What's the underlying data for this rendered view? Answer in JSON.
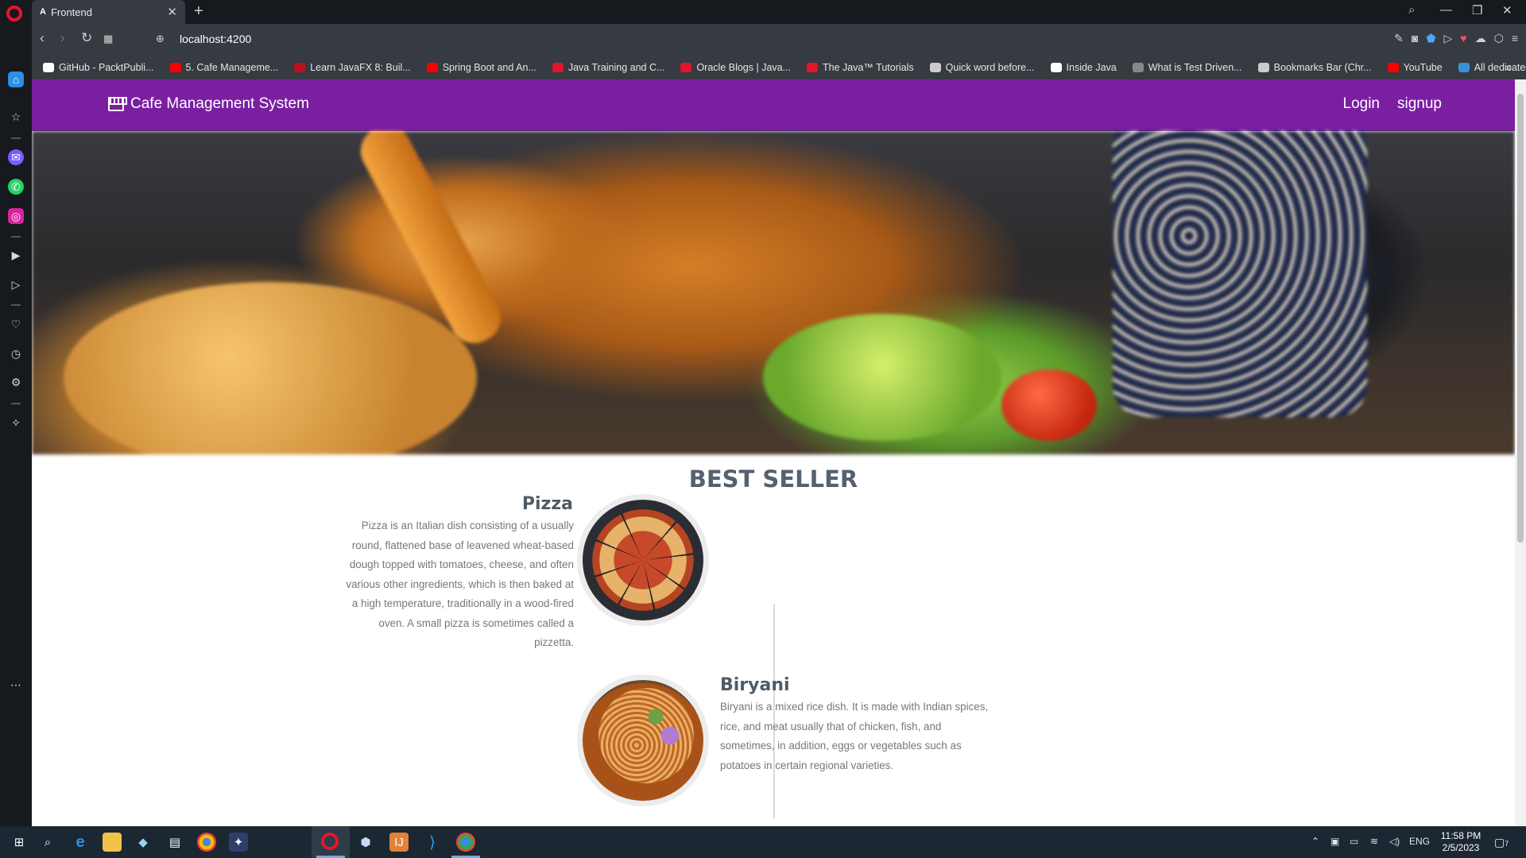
{
  "browser": {
    "tab_title": "Frontend",
    "tab_icon_glyph": "A",
    "close_glyph": "✕",
    "new_tab_glyph": "+",
    "url": "localhost:4200",
    "bookmarks": [
      {
        "label": "GitHub - PacktPubli...",
        "icon": "github-icon",
        "color": "#ffffff"
      },
      {
        "label": "5. Cafe Manageme...",
        "icon": "youtube-icon",
        "color": "#ff0000"
      },
      {
        "label": "Learn JavaFX 8: Buil...",
        "icon": "packt-icon",
        "color": "#b7121f"
      },
      {
        "label": "Spring Boot and An...",
        "icon": "youtube-icon",
        "color": "#ff0000"
      },
      {
        "label": "Java Training and C...",
        "icon": "oracle-icon",
        "color": "#e3152b"
      },
      {
        "label": "Oracle Blogs | Java...",
        "icon": "oracle-icon",
        "color": "#e3152b"
      },
      {
        "label": "The Java™ Tutorials",
        "icon": "oracle-icon",
        "color": "#e3152b"
      },
      {
        "label": "Quick word before...",
        "icon": "globe-icon",
        "color": "#cccccc"
      },
      {
        "label": "Inside Java",
        "icon": "page-icon",
        "color": "#ffffff"
      },
      {
        "label": "What is Test Driven...",
        "icon": "site-icon",
        "color": "#888888"
      },
      {
        "label": "Bookmarks Bar (Chr...",
        "icon": "folder-icon",
        "color": "#cccccc"
      },
      {
        "label": "YouTube",
        "icon": "youtube-icon",
        "color": "#ff0000"
      },
      {
        "label": "All dedicated MOO...",
        "icon": "infinity-icon",
        "color": "#3b8fd8"
      }
    ]
  },
  "page": {
    "brand": "Cafe Management System",
    "nav": {
      "login": "Login",
      "signup": "signup"
    },
    "section_title": "BEST SELLER",
    "items": [
      {
        "name": "Pizza",
        "description": "Pizza is an Italian dish consisting of a usually round, flattened base of leavened wheat-based dough topped with tomatoes, cheese, and often various other ingredients, which is then baked at a high temperature, traditionally in a wood-fired oven. A small pizza is sometimes called a pizzetta."
      },
      {
        "name": "Biryani",
        "description": "Biryani is a mixed rice dish. It is made with Indian spices, rice, and meat usually that of chicken, fish, and sometimes, in addition, eggs or vegetables such as potatoes in certain regional varieties."
      }
    ],
    "colors": {
      "appbar": "#7b1fa2",
      "title": "#556170"
    }
  },
  "taskbar": {
    "language": "ENG",
    "time": "11:58 PM",
    "date": "2/5/2023",
    "notification_count": "7"
  }
}
